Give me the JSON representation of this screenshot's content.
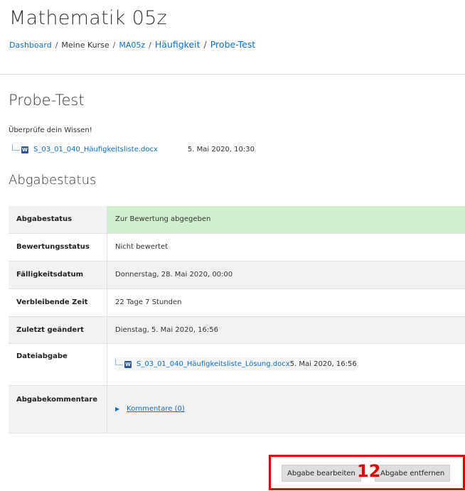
{
  "course_title": "Mathematik 05z",
  "breadcrumb": [
    "Dashboard",
    "Meine Kurse",
    "MA05z",
    "Häufigkeit",
    "Probe-Test"
  ],
  "assignment": {
    "title": "Probe-Test",
    "intro": "Überprüfe dein Wissen!",
    "file_name": "S_03_01_040_Häufigkeitsliste.docx",
    "file_date": "5. Mai 2020, 10:30",
    "file_icon": "word-doc-icon"
  },
  "status_heading": "Abgabestatus",
  "status_rows": [
    {
      "label": "Abgabestatus",
      "value": "Zur Bewertung abgegeben"
    },
    {
      "label": "Bewertungsstatus",
      "value": "Nicht bewertet"
    },
    {
      "label": "Fälligkeitsdatum",
      "value": "Donnerstag, 28. Mai 2020, 00:00"
    },
    {
      "label": "Verbleibende Zeit",
      "value": "22 Tage 7 Stunden"
    },
    {
      "label": "Zuletzt geändert",
      "value": "Dienstag, 5. Mai 2020, 16:56"
    },
    {
      "label": "Dateiabgabe",
      "file_name": "S_03_01_040_Häufigkeitsliste_Lösung.docx",
      "file_date": "5. Mai 2020, 16:56"
    },
    {
      "label": "Abgabekommentare",
      "link": "Kommentare (0)"
    }
  ],
  "buttons": {
    "edit": "Abgabe bearbeiten",
    "remove": "Abgabe entfernen"
  },
  "annotation_number": "12",
  "colors": {
    "link": "#0f6fc5",
    "submitted": "#cfefcf",
    "highlight": "#e00000"
  }
}
